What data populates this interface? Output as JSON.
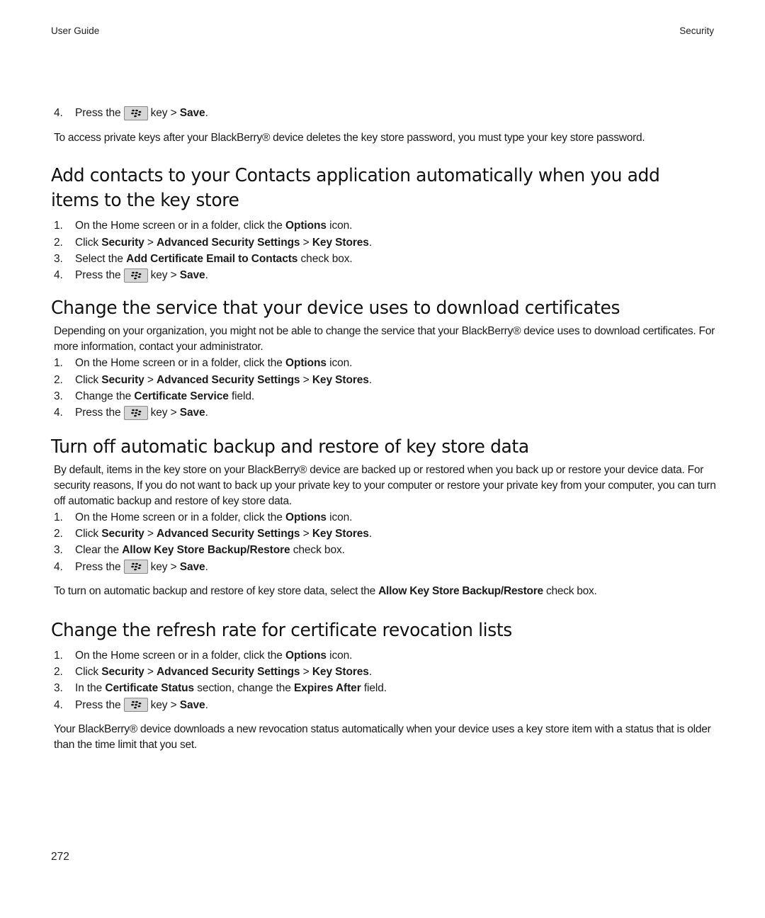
{
  "header": {
    "left": "User Guide",
    "right": "Security"
  },
  "icons": {
    "menu_key": "blackberry-menu-key-icon"
  },
  "intro": {
    "step4": {
      "num": "4.",
      "pre": "Press the",
      "post": "key >",
      "bold": "Save",
      "end": "."
    },
    "note": "To access private keys after your BlackBerry® device deletes the key store password, you must type your key store password."
  },
  "sections": [
    {
      "title": "Add contacts to your Contacts application automatically when you add items to the key store",
      "title_line1": "Add contacts to your Contacts application automatically when you add",
      "title_line2": "items to the key store",
      "steps": [
        {
          "num": "1.",
          "a": "On the Home screen or in a folder, click the ",
          "b1": "Options",
          "c": " icon."
        },
        {
          "num": "2.",
          "a": "Click ",
          "b1": "Security",
          "c": " > ",
          "b2": "Advanced Security Settings",
          "d": " > ",
          "b3": "Key Stores",
          "e": "."
        },
        {
          "num": "3.",
          "a": "Select the ",
          "b1": "Add Certificate Email to Contacts",
          "c": " check box."
        },
        {
          "num": "4.",
          "pre": "Press the",
          "post": "key >",
          "bold": "Save",
          "end": "."
        }
      ]
    },
    {
      "title": "Change the service that your device uses to download certificates",
      "intro": "Depending on your organization, you might not be able to change the service that your BlackBerry® device uses to download certificates. For more information, contact your administrator.",
      "steps": [
        {
          "num": "1.",
          "a": "On the Home screen or in a folder, click the ",
          "b1": "Options",
          "c": " icon."
        },
        {
          "num": "2.",
          "a": "Click ",
          "b1": "Security",
          "c": " > ",
          "b2": "Advanced Security Settings",
          "d": " > ",
          "b3": "Key Stores",
          "e": "."
        },
        {
          "num": "3.",
          "a": "Change the ",
          "b1": "Certificate Service",
          "c": " field."
        },
        {
          "num": "4.",
          "pre": "Press the",
          "post": "key >",
          "bold": "Save",
          "end": "."
        }
      ]
    },
    {
      "title": "Turn off automatic backup and restore of key store data",
      "intro": "By default, items in the key store on your BlackBerry® device are backed up or restored when you back up or restore your device data. For security reasons, If you do not want to back up your private key to your computer or restore your private key from your computer, you can turn off automatic backup and restore of key store data.",
      "steps": [
        {
          "num": "1.",
          "a": "On the Home screen or in a folder, click the ",
          "b1": "Options",
          "c": " icon."
        },
        {
          "num": "2.",
          "a": "Click ",
          "b1": "Security",
          "c": " > ",
          "b2": "Advanced Security Settings",
          "d": " > ",
          "b3": "Key Stores",
          "e": "."
        },
        {
          "num": "3.",
          "a": "Clear the ",
          "b1": "Allow Key Store Backup/Restore",
          "c": " check box."
        },
        {
          "num": "4.",
          "pre": "Press the",
          "post": "key >",
          "bold": "Save",
          "end": "."
        }
      ],
      "note": {
        "a": "To turn on automatic backup and restore of key store data, select the ",
        "b": "Allow Key Store Backup/Restore",
        "c": " check box."
      }
    },
    {
      "title": "Change the refresh rate for certificate revocation lists",
      "steps": [
        {
          "num": "1.",
          "a": "On the Home screen or in a folder, click the ",
          "b1": "Options",
          "c": " icon."
        },
        {
          "num": "2.",
          "a": "Click ",
          "b1": "Security",
          "c": " > ",
          "b2": "Advanced Security Settings",
          "d": " > ",
          "b3": "Key Stores",
          "e": "."
        },
        {
          "num": "3.",
          "a": "In the ",
          "b1": "Certificate Status",
          "c": " section, change the ",
          "b2": "Expires After",
          "d": " field."
        },
        {
          "num": "4.",
          "pre": "Press the",
          "post": "key >",
          "bold": "Save",
          "end": "."
        }
      ],
      "note": "Your BlackBerry® device downloads a new revocation status automatically when your device uses a key store item with a status that is older than the time limit that you set."
    }
  ],
  "footer": {
    "page_number": "272"
  }
}
